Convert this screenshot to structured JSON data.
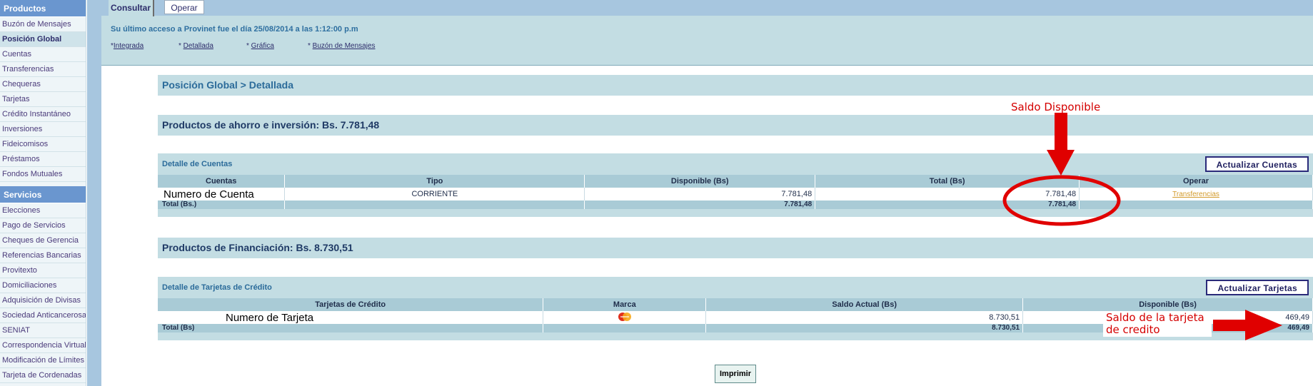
{
  "sidebar": {
    "productos_header": "Productos",
    "productos_items": [
      "Buzón de Mensajes",
      "Posición Global",
      "Cuentas",
      "Transferencias",
      "Chequeras",
      "Tarjetas",
      "Crédito Instantáneo",
      "Inversiones",
      "Fideicomisos",
      "Préstamos",
      "Fondos Mutuales"
    ],
    "servicios_header": "Servicios",
    "servicios_items": [
      "Elecciones",
      "Pago de Servicios",
      "Cheques de Gerencia",
      "Referencias Bancarias",
      "Provitexto",
      "Domiciliaciones",
      "Adquisición de Divisas",
      "Sociedad Anticancerosa",
      "SENIAT",
      "Correspondencia Virtual",
      "Modificación de Límites",
      "Tarjeta de Cordenadas"
    ]
  },
  "tabs": {
    "consultar": "Consultar",
    "operar": "Operar"
  },
  "last_access": "Su último acceso a Provinet fue el día 25/08/2014 a las 1:12:00 p.m",
  "sublinks": [
    "Integrada",
    "Detallada",
    "Gráfica",
    "Buzón de Mensajes"
  ],
  "breadcrumb": "Posición Global > Detallada",
  "ahorro_title": "Productos de ahorro e inversión: Bs. 7.781,48",
  "cuentas": {
    "section_title": "Detalle de Cuentas",
    "update_button": "Actualizar Cuentas",
    "headers": [
      "Cuentas",
      "Tipo",
      "Disponible (Bs)",
      "Total (Bs)",
      "Operar"
    ],
    "row": {
      "cuenta": "Numero de Cuenta",
      "tipo": "CORRIENTE",
      "disponible": "7.781,48",
      "total": "7.781,48",
      "operar": "Transferencias"
    },
    "totals": {
      "label": "Total (Bs.)",
      "disponible": "7.781,48",
      "total": "7.781,48"
    }
  },
  "financ_title": "Productos de Financiación: Bs. 8.730,51",
  "tarjetas": {
    "section_title": "Detalle de Tarjetas de Crédito",
    "update_button": "Actualizar Tarjetas",
    "headers": [
      "Tarjetas de Crédito",
      "Marca",
      "Saldo Actual (Bs)",
      "Disponible (Bs)"
    ],
    "row": {
      "tarjeta": "Numero de Tarjeta",
      "saldo": "8.730,51",
      "disponible": "469,49"
    },
    "totals": {
      "label": "Total (Bs)",
      "saldo": "8.730,51",
      "disponible": "469,49"
    }
  },
  "print_button": "Imprimir",
  "annotations": {
    "saldo_disponible": "Saldo Disponible",
    "saldo_tarjeta_line1": "Saldo de la tarjeta",
    "saldo_tarjeta_line2": "de credito",
    "color": "#e00000"
  }
}
